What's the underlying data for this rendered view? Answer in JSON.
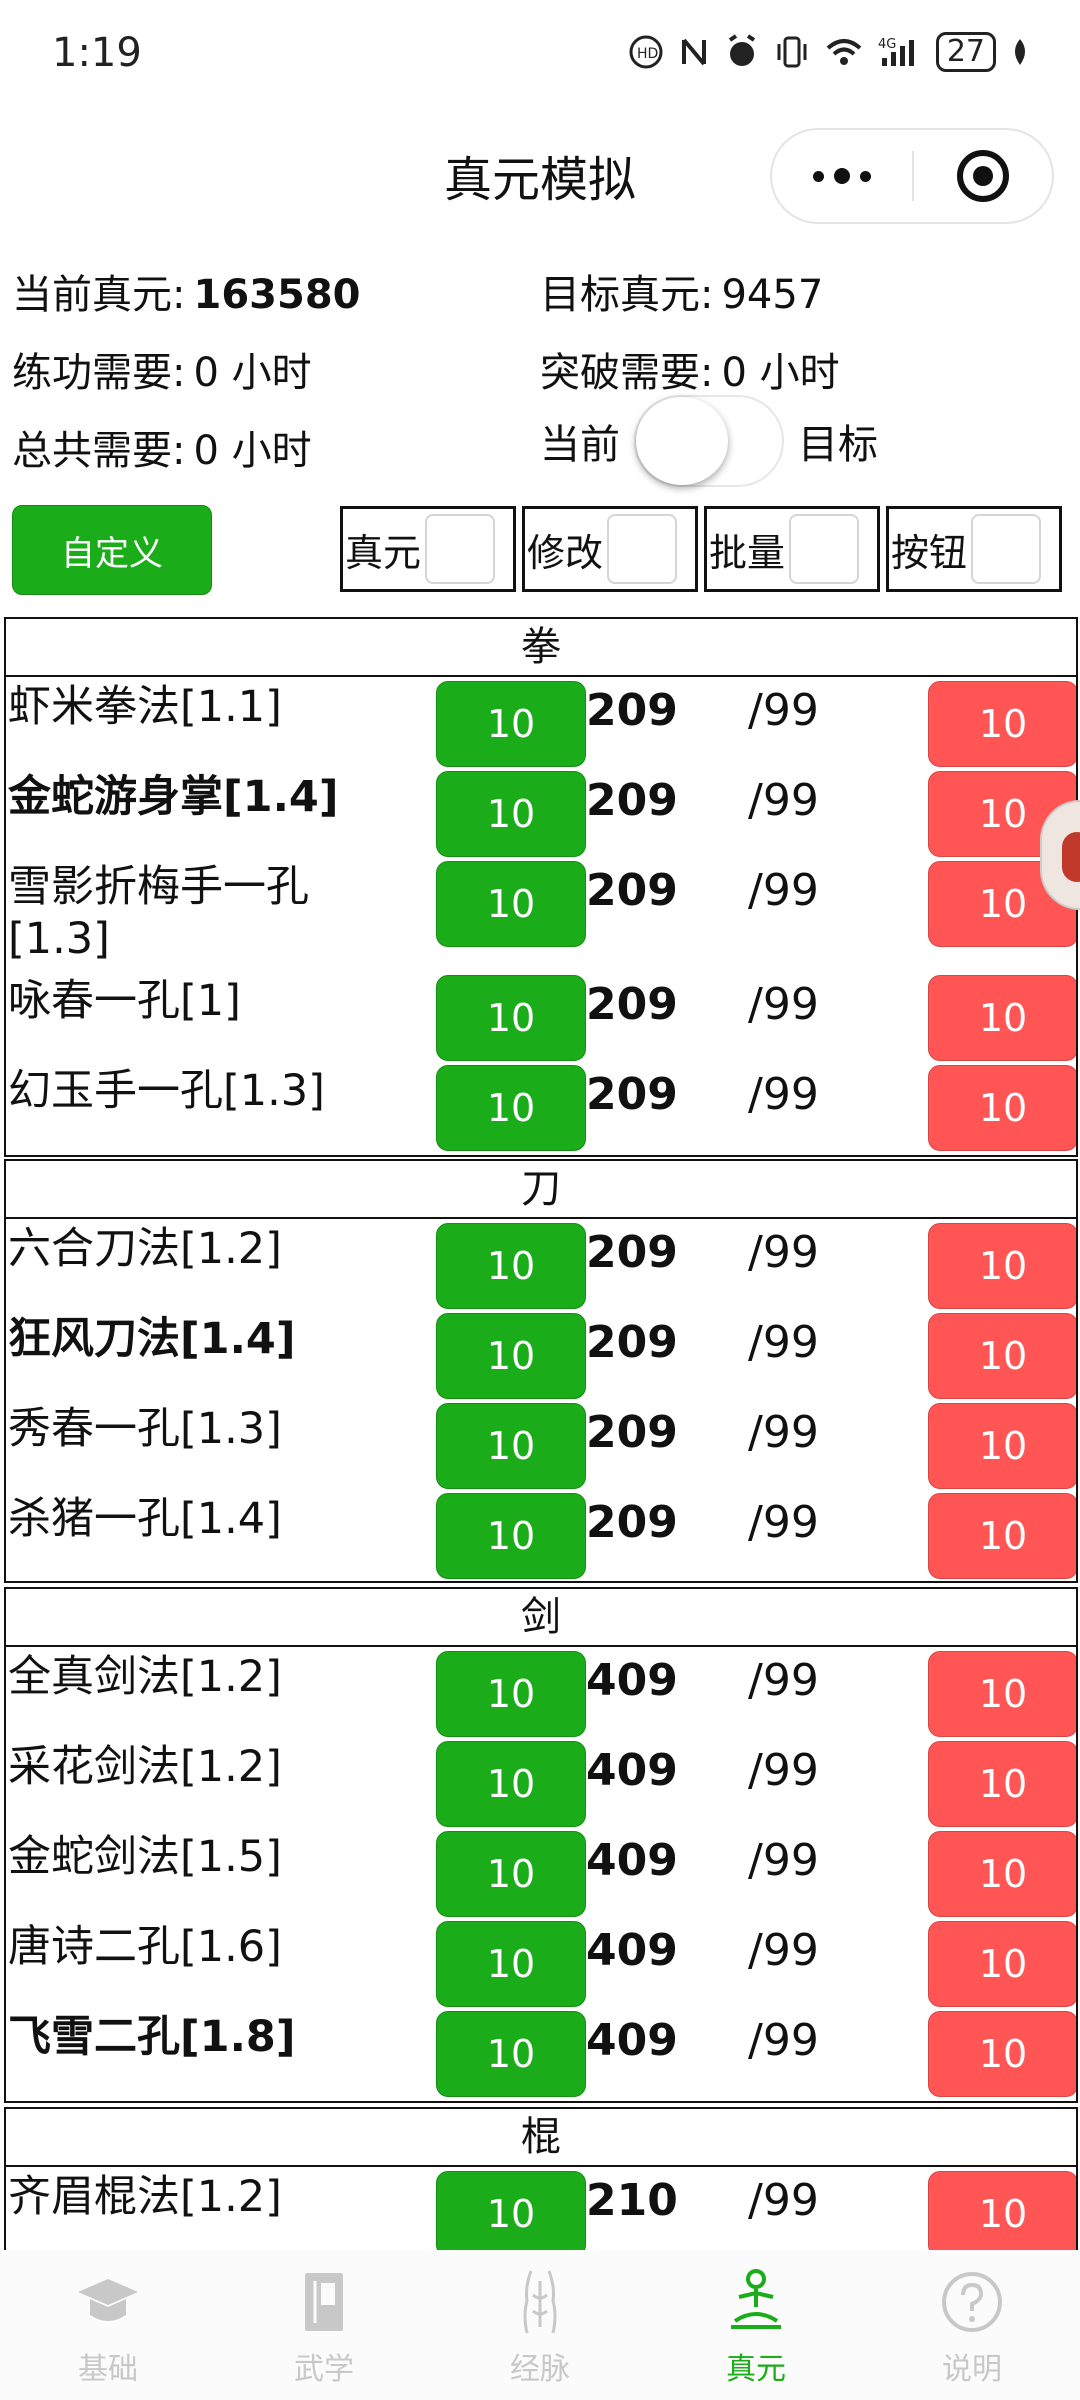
{
  "status": {
    "time": "1:19",
    "battery": "27"
  },
  "header": {
    "title": "真元模拟"
  },
  "info": {
    "current_label": "当前真元:",
    "current_value": "163580",
    "target_label": "目标真元:",
    "target_value": "9457",
    "practice_label": "练功需要:",
    "practice_value": "0 小时",
    "breakthrough_label": "突破需要:",
    "breakthrough_value": "0 小时",
    "total_label": "总共需要:",
    "total_value": "0 小时",
    "toggle_left": "当前",
    "toggle_right": "目标"
  },
  "controls": {
    "custom_label": "自定义",
    "checkboxes": [
      "真元",
      "修改",
      "批量",
      "按钮"
    ]
  },
  "sections": [
    {
      "name": "拳",
      "items": [
        {
          "name": "虾米拳法[1.1]",
          "green": "10",
          "value": "209",
          "max": "/99",
          "red": "10"
        },
        {
          "name": "金蛇游身掌[1.4]",
          "green": "10",
          "value": "209",
          "max": "/99",
          "red": "10"
        },
        {
          "name": "雪影折梅手一孔[1.3]",
          "green": "10",
          "value": "209",
          "max": "/99",
          "red": "10"
        },
        {
          "name": "咏春一孔[1]",
          "green": "10",
          "value": "209",
          "max": "/99",
          "red": "10"
        },
        {
          "name": "幻玉手一孔[1.3]",
          "green": "10",
          "value": "209",
          "max": "/99",
          "red": "10"
        }
      ]
    },
    {
      "name": "刀",
      "items": [
        {
          "name": "六合刀法[1.2]",
          "green": "10",
          "value": "209",
          "max": "/99",
          "red": "10"
        },
        {
          "name": "狂风刀法[1.4]",
          "green": "10",
          "value": "209",
          "max": "/99",
          "red": "10"
        },
        {
          "name": "秀春一孔[1.3]",
          "green": "10",
          "value": "209",
          "max": "/99",
          "red": "10"
        },
        {
          "name": "杀猪一孔[1.4]",
          "green": "10",
          "value": "209",
          "max": "/99",
          "red": "10"
        }
      ]
    },
    {
      "name": "剑",
      "items": [
        {
          "name": "全真剑法[1.2]",
          "green": "10",
          "value": "409",
          "max": "/99",
          "red": "10"
        },
        {
          "name": "采花剑法[1.2]",
          "green": "10",
          "value": "409",
          "max": "/99",
          "red": "10"
        },
        {
          "name": "金蛇剑法[1.5]",
          "green": "10",
          "value": "409",
          "max": "/99",
          "red": "10"
        },
        {
          "name": "唐诗二孔[1.6]",
          "green": "10",
          "value": "409",
          "max": "/99",
          "red": "10"
        },
        {
          "name": "飞雪二孔[1.8]",
          "green": "10",
          "value": "409",
          "max": "/99",
          "red": "10"
        }
      ]
    },
    {
      "name": "棍",
      "items": [
        {
          "name": "齐眉棍法[1.2]",
          "green": "10",
          "value": "210",
          "max": "/99",
          "red": "10"
        }
      ]
    }
  ],
  "tabbar": {
    "tabs": [
      {
        "label": "基础",
        "icon": "mortarboard-icon"
      },
      {
        "label": "武学",
        "icon": "book-icon"
      },
      {
        "label": "经脉",
        "icon": "body-meridian-icon"
      },
      {
        "label": "真元",
        "icon": "meditation-icon"
      },
      {
        "label": "说明",
        "icon": "help-icon"
      }
    ],
    "active_index": 3
  },
  "colors": {
    "green": "#1aad19",
    "red": "#ff5555",
    "inactive_tab": "#c8c8c8"
  }
}
